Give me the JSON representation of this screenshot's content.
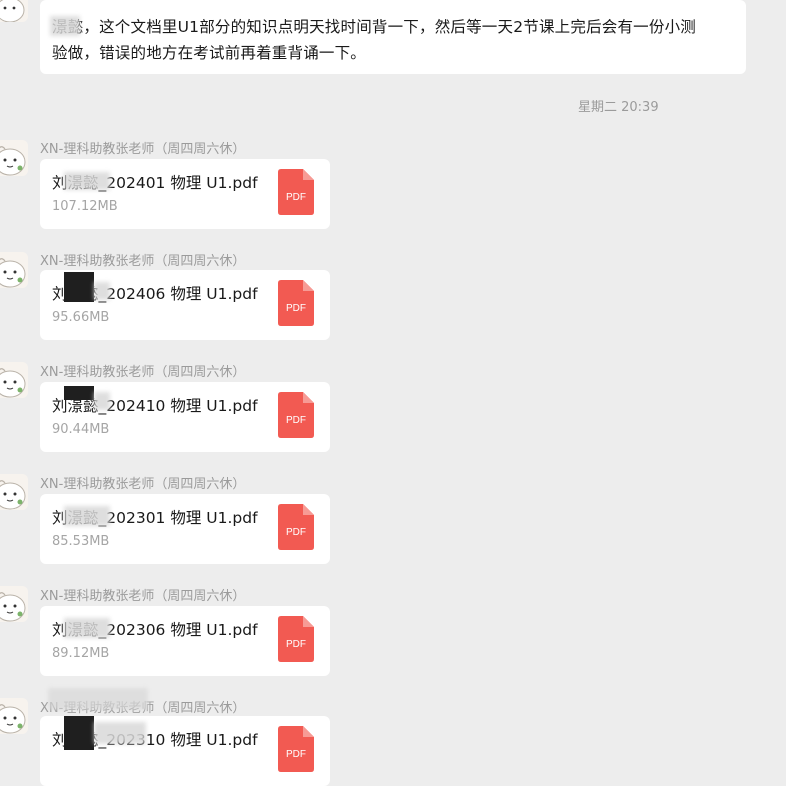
{
  "chat": {
    "text_message": "澋懿，这个文档里U1部分的知识点明天找时间背一下，然后等一天2节课上完后会有一份小测\n验做，错误的地方在考试前再着重背诵一下。",
    "timestamp": "星期二 20:39",
    "sender_name": "XN-理科助教张老师（周四周六休）",
    "pdf_badge": "PDF",
    "files": [
      {
        "name": "刘澋懿_202401 物理 U1.pdf",
        "size": "107.12MB"
      },
      {
        "name": "刘澋懿_202406 物理 U1.pdf",
        "size": "95.66MB"
      },
      {
        "name": "刘澋懿_202410 物理 U1.pdf",
        "size": "90.44MB"
      },
      {
        "name": "刘澋懿_202301 物理 U1.pdf",
        "size": "85.53MB"
      },
      {
        "name": "刘澋懿_202306 物理 U1.pdf",
        "size": "89.12MB"
      },
      {
        "name": "刘澋懿_202310 物理 U1.pdf",
        "size": ""
      }
    ]
  },
  "colors": {
    "background": "#ededed",
    "bubble": "#ffffff",
    "pdf_red": "#f25a52",
    "meta_gray": "#9b9b9b"
  }
}
